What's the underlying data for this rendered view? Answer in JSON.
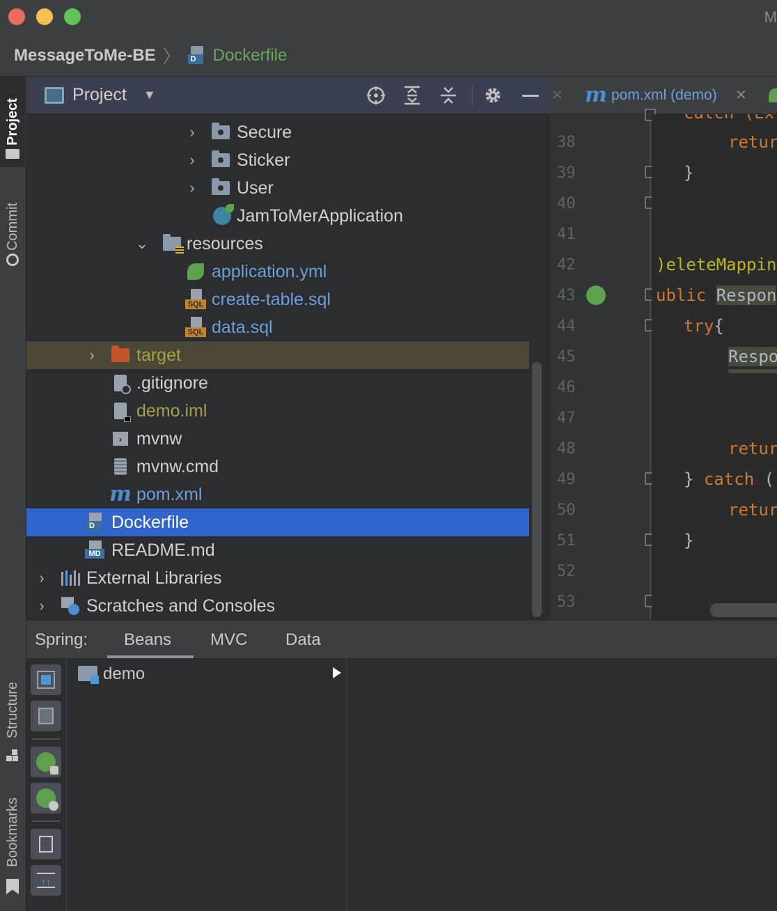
{
  "window": {
    "title_partial": "M"
  },
  "breadcrumb": {
    "project": "MessageToMe-BE",
    "file": "Dockerfile"
  },
  "left_strip": {
    "project_tab": "Project",
    "commit_tab": "Commit",
    "structure_tab": "Structure",
    "bookmarks_tab": "Bookmarks"
  },
  "project_panel": {
    "title": "Project"
  },
  "tree": [
    {
      "label": "Secure"
    },
    {
      "label": "Sticker"
    },
    {
      "label": "User"
    },
    {
      "label": "JamToMerApplication"
    },
    {
      "label": "resources"
    },
    {
      "label": "application.yml"
    },
    {
      "label": "create-table.sql"
    },
    {
      "label": "data.sql"
    },
    {
      "label": "target"
    },
    {
      "label": ".gitignore"
    },
    {
      "label": "demo.iml"
    },
    {
      "label": "mvnw"
    },
    {
      "label": "mvnw.cmd"
    },
    {
      "label": "pom.xml"
    },
    {
      "label": "Dockerfile"
    },
    {
      "label": "README.md"
    },
    {
      "label": "External Libraries"
    },
    {
      "label": "Scratches and Consoles"
    }
  ],
  "editor": {
    "tab_label": "pom.xml (demo)",
    "line_numbers": [
      "38",
      "39",
      "40",
      "41",
      "42",
      "43",
      "44",
      "45",
      "46",
      "47",
      "48",
      "49",
      "50",
      "51",
      "52",
      "53"
    ],
    "code": {
      "l37": "catch (Ex",
      "l38": "retur",
      "l39": "}",
      "l42": ")eleteMappin",
      "l43a": "ublic ",
      "l43b": "Respon",
      "l44a": "try",
      "l44b": "{",
      "l45": "Respo",
      "l48": "retur",
      "l49a": "} ",
      "l49b": "catch",
      "l49c": " (",
      "l50": "retur",
      "l51": "}"
    }
  },
  "spring": {
    "label": "Spring:",
    "tabs": [
      "Beans",
      "MVC",
      "Data"
    ],
    "active_tab": "Beans",
    "tree_item": "demo"
  },
  "colors": {
    "selection": "#2f65ca",
    "target_row": "#4b4636",
    "accent_green": "#6fa657",
    "link_blue": "#6c9fd8"
  }
}
